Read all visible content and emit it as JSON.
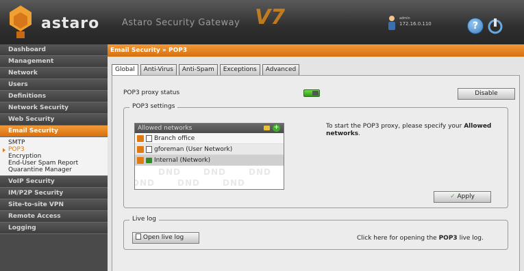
{
  "header": {
    "logo_text": "astaro",
    "product_title": "Astaro Security Gateway",
    "version": "V7",
    "user_name": "admin",
    "user_ip": "172.16.0.110",
    "help_symbol": "?",
    "icons": {
      "help": "help-icon",
      "logout": "logout-icon",
      "user": "user-icon"
    }
  },
  "sidebar": {
    "items_top": [
      {
        "label": "Dashboard"
      },
      {
        "label": "Management"
      },
      {
        "label": "Network"
      },
      {
        "label": "Users"
      },
      {
        "label": "Definitions"
      },
      {
        "label": "Network Security"
      },
      {
        "label": "Web Security"
      }
    ],
    "active_item": {
      "label": "Email Security"
    },
    "sub_items": [
      {
        "label": "SMTP"
      },
      {
        "label": "POP3"
      },
      {
        "label": "Encryption"
      },
      {
        "label": "End-User Spam Report"
      },
      {
        "label": "Quarantine Manager"
      }
    ],
    "items_bottom": [
      {
        "label": "VoIP Security"
      },
      {
        "label": "IM/P2P Security"
      },
      {
        "label": "Site-to-site VPN"
      },
      {
        "label": "Remote Access"
      },
      {
        "label": "Logging"
      }
    ]
  },
  "main": {
    "breadcrumb": "Email Security » POP3",
    "tabs": [
      {
        "label": "Global"
      },
      {
        "label": "Anti-Virus"
      },
      {
        "label": "Anti-Spam"
      },
      {
        "label": "Exceptions"
      },
      {
        "label": "Advanced"
      }
    ],
    "status_label": "POP3 proxy status",
    "status_enabled": true,
    "disable_button": "Disable",
    "settings_legend": "POP3 settings",
    "allowed_networks_header": "Allowed networks",
    "networks": [
      {
        "label": "Branch office",
        "type": "host"
      },
      {
        "label": "gforeman (User Network)",
        "type": "host"
      },
      {
        "label": "Internal (Network)",
        "type": "network"
      }
    ],
    "dnd_label": "DND",
    "hint_prefix": "To start the POP3 proxy, please specify your",
    "hint_bold": "Allowed networks",
    "hint_suffix": ".",
    "apply_button": "Apply",
    "livelog_legend": "Live log",
    "open_livelog_button": "Open live log",
    "livelog_text_prefix": "Click here for opening the",
    "livelog_text_bold": "POP3",
    "livelog_text_suffix": "live log.",
    "colors": {
      "accent": "#e07a12",
      "toggle_on": "#3fae2a"
    }
  }
}
